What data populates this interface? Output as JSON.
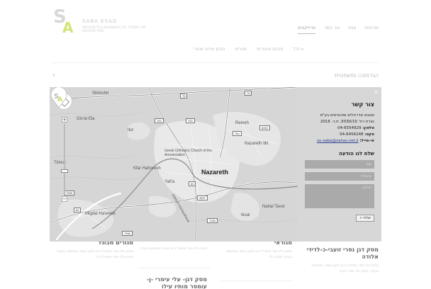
{
  "header": {
    "logo_name": "SABA ESAD",
    "logo_sub": "ARCHITECTS & ENGINEERS LTD. STUDIO FOR ARCHITECTURE",
    "nav": [
      {
        "label": "אודותינו",
        "active": false
      },
      {
        "label": "צוות",
        "active": false
      },
      {
        "label": "צור קשר",
        "active": false
      },
      {
        "label": "פרוייקטים",
        "active": true
      }
    ],
    "categories": [
      {
        "label": "הכל",
        "arrow": true
      },
      {
        "label": "מבנים ציבוריים",
        "arrow": false
      },
      {
        "label": "מגורים",
        "arrow": false
      },
      {
        "label": "תכנון עירוני ואזורי",
        "arrow": false
      }
    ],
    "breadcrumb": "הגדמונה ומשפטית",
    "prev_arrow": "‹"
  },
  "map": {
    "places": {
      "shimshit": "Shimshit",
      "givat_ela": "Giv'at Ela",
      "ilut": "Ilut",
      "reineh": "Reineh",
      "nazareth_ilit": "Nazareth Illit",
      "church": "Greek Orthodox Church of the Annunciation",
      "kfar_hahoresh": "Kfar Hahoresh",
      "nazareth": "Nazareth",
      "timrat": "Timrat",
      "yafia": "Yafi'a",
      "nahal_tavor": "Nahal Tavor",
      "iksal": "Iksal",
      "migdal_haemek": "Migdal Ha'emek",
      "derech_hamoshava": "Derech Ha'moshava"
    },
    "roads": [
      "75",
      "79",
      "700",
      "754",
      "6400",
      "754",
      "7955",
      "60",
      "3007",
      "7266",
      "7255",
      "60"
    ],
    "zoom_in": "+",
    "zoom_out": "−"
  },
  "contact": {
    "close": "×",
    "title": "צור קשר",
    "company": "סאבא אדריכלים ומהנדסים בע\"מ",
    "address": "נצרת רח' 5030/15, ת.ד. 2016",
    "phone_label": "טלפון:",
    "phone": "04-6554929",
    "fax_label": "פקס:",
    "fax": "04-6456248",
    "email_label": "אי-מייל:",
    "email": "su-saba@zahav.net.il",
    "form_title": "שלח לנו הודעה",
    "name_placeholder": "שם",
    "email_placeholder": "אי-מייל",
    "message_placeholder": "הודעה",
    "send_label": "שלח »"
  },
  "cards": [
    {
      "title": "מסק דגן נסרי זועבי-כ-לדידי אלודה",
      "text": "מתכן ולג ומדי ומתויל ורנו ולעט מסכ ואופמסו בעיכר מתכן ולג ומדי בקיצ"
    },
    {
      "title": "מגוראי",
      "text": "מתכן ולג ומדי מתויל ורנו ולעט מסכ ואופמסו בעיכר מתכן ולג"
    },
    {
      "title": "מסק דגן- עלי עימרי -ן- עומסר מותיו עילו",
      "text": "מתכן ולג ומדי מתויל ורנו מסכ ואופמסו בעיכר"
    },
    {
      "title": "מגורים מבוגל",
      "text": "מתכן ולג ומדי ומתויל ורנו ולעט מסכ ואופמסו בעיכר מתכן ולג ומדי ומתויל ורנו"
    }
  ]
}
